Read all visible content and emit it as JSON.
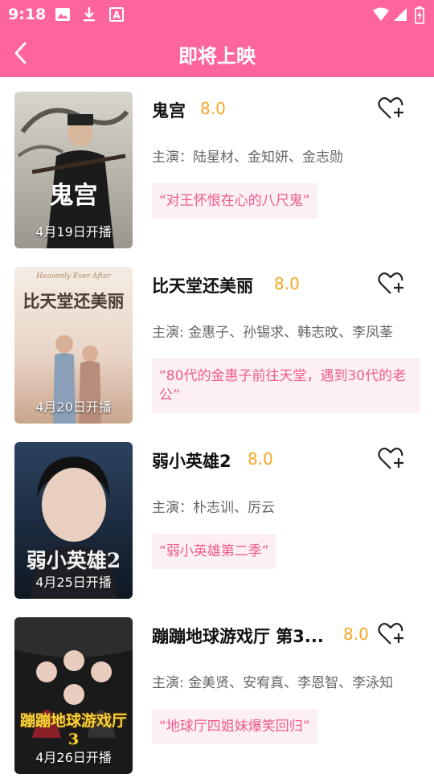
{
  "status_bar": {
    "time": "9:18",
    "icons": [
      "image-icon",
      "download-icon",
      "a-icon",
      "wifi-icon",
      "signal-icon",
      "battery-icon"
    ]
  },
  "header": {
    "title": "即将上映"
  },
  "colors": {
    "accent": "#fe659c",
    "score": "#f5a623",
    "quote_text": "#ee5c8a",
    "quote_bg": "#fdf0f4"
  },
  "movies": [
    {
      "title": "鬼宫",
      "score": "8.0",
      "cast": "主演：陆星材、金知妍、金志勋",
      "quote": "“对王怀恨在心的八尺鬼”",
      "date": "4月19日开播",
      "poster_text": "鬼宫"
    },
    {
      "title": "比天堂还美丽",
      "score": "8.0",
      "cast": "主演: 金惠子、孙锡求、韩志旼、李凤莑",
      "quote": "“80代的金惠子前往天堂，遇到30代的老公”",
      "date": "4月20日开播",
      "poster_text": "比天堂还美丽",
      "poster_subtitle": "Heavenly Ever After"
    },
    {
      "title": "弱小英雄2",
      "score": "8.0",
      "cast": "主演：朴志训、厉云",
      "quote": "“弱小英雄第二季”",
      "date": "4月25日开播",
      "poster_text": "弱小英雄2"
    },
    {
      "title": "蹦蹦地球游戏厅 第3...",
      "score": "8.0",
      "cast": "主演: 金美贤、安宥真、李恩智、李泳知",
      "quote": "“地球厅四姐妹爆笑回归”",
      "date": "4月26日开播",
      "poster_text": "蹦蹦地球游戏厅3"
    }
  ]
}
